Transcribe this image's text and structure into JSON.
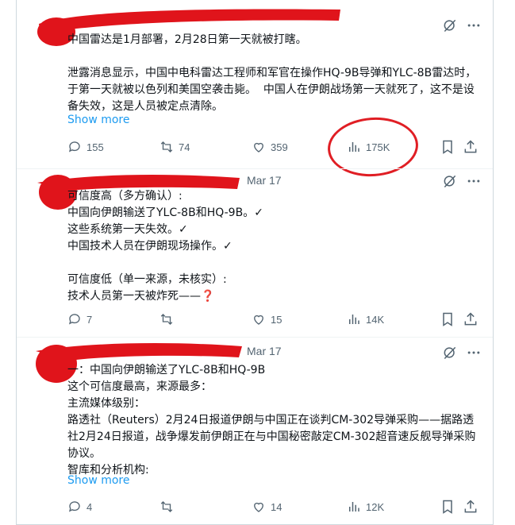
{
  "posts": [
    {
      "text_main": "中国雷达是1月部署，2月28日第一天就被打瞎。\n\n泄露消息显示，中国中电科雷达工程师和军官在操作HQ-9B导弹和YLC-8B雷达时，于第一天就被以色列和美国空袭击毙。 中国人在伊朗战场第一天就死了，这不是设备失效，这是人员被定点清除。",
      "show_more": "Show more",
      "replies": "155",
      "reposts": "74",
      "likes": "359",
      "views": "175K"
    },
    {
      "date": "Mar 17",
      "text_main": "可信度高（多方确认）:\n中国向伊朗输送了YLC-8B和HQ-9B。✓\n这些系统第一天失效。✓\n中国技术人员在伊朗现场操作。✓\n\n可信度低（单一来源，未核实）:\n技术人员第一天被炸死——",
      "question_mark": "❓",
      "replies": "7",
      "reposts": "",
      "likes": "15",
      "views": "14K"
    },
    {
      "date": "Mar 17",
      "text_main": "一：中国向伊朗输送了YLC-8B和HQ-9B\n这个可信度最高，来源最多：\n主流媒体级别：\n路透社（Reuters）2月24日报道伊朗与中国正在谈判CM-302导弹采购——据路透社2月24日报道，战争爆发前伊朗正在与中国秘密敲定CM-302超音速反舰导弹采购协议。 \n智库和分析机构:",
      "show_more": "Show more",
      "replies": "4",
      "reposts": "",
      "likes": "14",
      "views": "12K"
    }
  ],
  "colors": {
    "text": "#0f1419",
    "muted": "#536471",
    "link": "#1d9bf0",
    "scribble": "#e0141b"
  },
  "icons": [
    "grok-icon",
    "more-icon",
    "reply-icon",
    "repost-icon",
    "like-icon",
    "views-icon",
    "bookmark-icon",
    "share-icon"
  ]
}
